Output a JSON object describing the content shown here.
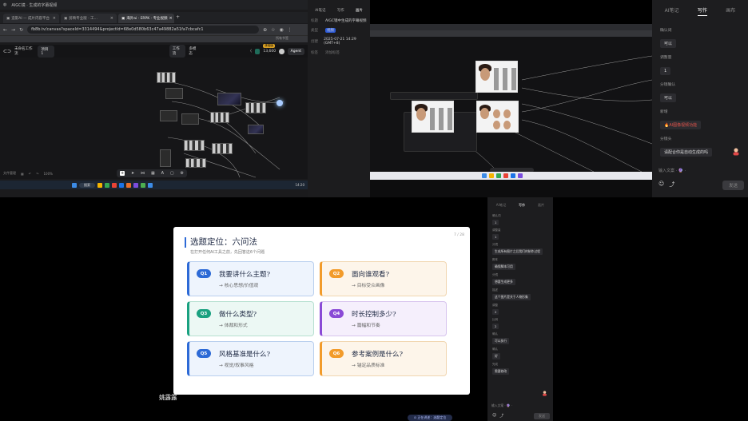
{
  "browser": {
    "os_items": [
      "AIGC镜 · 生成的字幕视频"
    ],
    "tabs": [
      {
        "label": "造影AI — 成片内容平台"
      },
      {
        "label": "剪映专业版 · 工…"
      },
      {
        "label": "海外ai · ERPK · 专业视频",
        "active": true
      }
    ],
    "url": "fb8b.tv/canvas?spaceId=3314494&projectId=68e0d580b63c47a49882a51fa7cbcafc1",
    "bookmarks": "所有书签",
    "app_title": "未命名工作流",
    "app_sub": "项目 1",
    "mode_label": "工作流",
    "mode_label2": "多模态",
    "credits_label": "13,600",
    "agent_label": "Agent",
    "upgrade_badge": "体验版",
    "canvas_bottom": [
      "文件管理",
      "100%"
    ],
    "taskbar_search": "搜索",
    "clock": "14:20"
  },
  "midpanel": {
    "tabs": [
      "AI笔记",
      "写作",
      "画片"
    ],
    "rows": [
      {
        "k": "标题",
        "v": "AIGC镜中生成的字幕视频"
      },
      {
        "k": "类型",
        "v": "视频"
      },
      {
        "k": "创建",
        "v": "2025-07-21 14:29 (GMT+8)"
      },
      {
        "k": "标签",
        "v": "添加标签"
      }
    ]
  },
  "rpanel": {
    "tabs": [
      "AI笔记",
      "写作",
      "画布"
    ],
    "active_tab": 1,
    "items": [
      {
        "label": "确认词",
        "value": "可以"
      },
      {
        "label": "调整量",
        "value": "1"
      },
      {
        "label": "分镜确认",
        "value": "可以"
      },
      {
        "label": "新增",
        "value": "AI图像视频功能",
        "fire": true
      },
      {
        "label": "分镜头",
        "value": "请配合你是自动生成的吗"
      }
    ],
    "input_placeholder": "输入文案 · 🔮 ·",
    "send_label": "发送"
  },
  "slide": {
    "title": "选题定位：六问法",
    "subtitle": "在打开任何AI工具之前，先回答这6个问题",
    "page": "7 / 28",
    "cards": [
      {
        "q": "Q1",
        "title": "我要讲什么主题?",
        "sub": "→ 核心思想/价值观",
        "color": "#2d6ad6",
        "style": "c-blue"
      },
      {
        "q": "Q2",
        "title": "面向谁观看?",
        "sub": "→ 目标受众画像",
        "color": "#f29b2a",
        "style": "c-orange"
      },
      {
        "q": "Q3",
        "title": "做什么类型?",
        "sub": "→ 体裁和形式",
        "color": "#1aa180",
        "style": "c-green"
      },
      {
        "q": "Q4",
        "title": "时长控制多少?",
        "sub": "→ 篇幅和节奏",
        "color": "#8a4ad6",
        "style": "c-purple"
      },
      {
        "q": "Q5",
        "title": "风格基准是什么?",
        "sub": "→ 视觉/叙事风格",
        "color": "#2d6ad6",
        "style": "c-blue"
      },
      {
        "q": "Q6",
        "title": "参考案例是什么?",
        "sub": "→ 锚定品质标准",
        "color": "#f29b2a",
        "style": "c-orange"
      }
    ]
  },
  "speaker": "姚露露",
  "bottom_pill": "⊙ 正在讲述：选题定位",
  "rpanel2": {
    "tabs": [
      "AI笔记",
      "写作",
      "画片"
    ],
    "items": [
      {
        "k": "确认词",
        "v": "1"
      },
      {
        "k": "调整量",
        "v": "1"
      },
      {
        "k": "分镜",
        "v": "生成所有图片之后我们的制作过程"
      },
      {
        "k": "脚本",
        "v": "确保脚本可用"
      },
      {
        "k": "分镜",
        "v": "想要生成更多"
      },
      {
        "k": "描述",
        "v": "这个图片是关于人物形象"
      },
      {
        "k": "调整",
        "v": "2"
      },
      {
        "k": "比例",
        "v": "2"
      },
      {
        "k": "确认",
        "v": "可以执行"
      },
      {
        "k": "确认",
        "v": "好"
      },
      {
        "k": "完成",
        "v": "需要修改"
      }
    ],
    "input": "输入文案 · 🔮 ·",
    "send": "发送"
  }
}
